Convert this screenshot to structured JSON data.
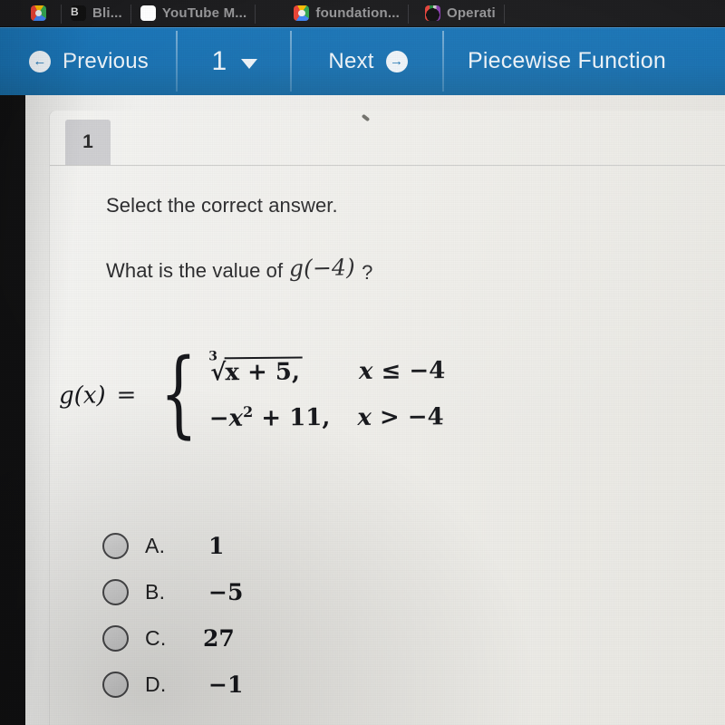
{
  "browser": {
    "tabs": [
      {
        "title": "",
        "icon": "chrome-icon",
        "icon_kind": "chrome"
      },
      {
        "title": "Bli...",
        "icon": "b-letter-icon",
        "icon_kind": "bletter",
        "icon_text": "B"
      },
      {
        "title": "YouTube M...",
        "icon": "youtube-music-icon",
        "icon_kind": "youtube"
      },
      {
        "title": "foundation...",
        "icon": "chrome-icon",
        "icon_kind": "chrome"
      },
      {
        "title": "Operati",
        "icon": "operations-icon",
        "icon_kind": "operations"
      }
    ]
  },
  "nav": {
    "previous_label": "Previous",
    "previous_icon": "circle-arrow-left-icon",
    "previous_glyph": "←",
    "page_number": "1",
    "page_dropdown_icon": "chevron-down-icon",
    "next_label": "Next",
    "next_icon": "circle-arrow-right-icon",
    "next_glyph": "→",
    "assignment_title": "Piecewise Function",
    "bar_color": "#1b76b8"
  },
  "question": {
    "number_tab": "1",
    "instruction": "Select the correct answer.",
    "prompt_text": "What is the value of",
    "prompt_math": "g(−4)",
    "prompt_suffix": "?",
    "formula": {
      "function_name": "g(x)",
      "equals": "=",
      "cases": [
        {
          "expression_root_index": "3",
          "expression_radicand": "x + 5,",
          "condition": "x ≤ −4"
        },
        {
          "expression_plain": "−x² + 11,",
          "condition": "x > −4"
        }
      ],
      "plain_text": "g(x) = { cbrt(x + 5), x ≤ −4 ; −x² + 11, x > −4 }"
    },
    "options": [
      {
        "letter": "A.",
        "value": "1",
        "selected": false
      },
      {
        "letter": "B.",
        "value": "−5",
        "selected": false
      },
      {
        "letter": "C.",
        "value": "27",
        "selected": false
      },
      {
        "letter": "D.",
        "value": "−1",
        "selected": false
      }
    ]
  }
}
